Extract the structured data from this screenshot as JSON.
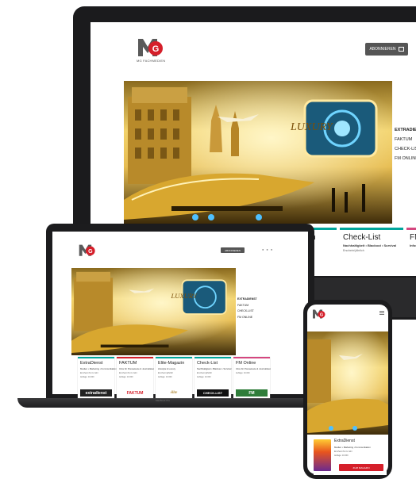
{
  "brand": {
    "logo_letters": "MG",
    "tagline": "MG FACHMEDIEN"
  },
  "monitor": {
    "subscribe_label": "ABONNIEREN",
    "hero_text": "LUXURY",
    "menu": [
      "EXTRADIENST",
      "FAKTUM",
      "CHECK-LIST",
      "FM ONLINE"
    ],
    "cards": [
      {
        "title": "n",
        "subtitle": "",
        "extra": ""
      },
      {
        "title": "Check-List",
        "subtitle": "Nachhaltigkeit • Blackout • Survival",
        "extra": "Erscheint jährlich"
      },
      {
        "title": "FM",
        "subtitle": "Infor",
        "extra": ""
      }
    ]
  },
  "laptop": {
    "subscribe_label": "ABONNIEREN",
    "hero_text": "LUXURY",
    "base_label": "MacBook Pro",
    "menu": [
      "EXTRADIENST",
      "FAKTUM",
      "CHECK-LIST",
      "FM ONLINE"
    ],
    "cards": [
      {
        "title": "ExtraDienst",
        "subtitle": "Medien • Marketing • Kommunikation",
        "extra": "Erscheint 6x im Jahr",
        "extra2": "Auflage: 10.000",
        "logo": "extradienst"
      },
      {
        "title": "FAKTUM",
        "subtitle": "Infos für Presseleute & Journalisten",
        "extra": "Erscheint 6x im Jahr",
        "extra2": "Auflage: 10.000",
        "logo": "FAKTUM"
      },
      {
        "title": "Elite-Magazin",
        "subtitle": "Lifestyle & Luxury",
        "extra": "Erscheint jährlich",
        "extra2": "Auflage: 10.000",
        "logo": "élite"
      },
      {
        "title": "Check-List",
        "subtitle": "Nachhaltigkeit • Blackout • Survival",
        "extra": "Erscheint jährlich",
        "extra2": "Auflage: 10.000",
        "logo": "CHECK-LIST"
      },
      {
        "title": "FM Online",
        "subtitle": "Infos für Presseleute & Journalisten",
        "extra": "Auflage: 10.000",
        "extra2": "",
        "logo": "FM"
      }
    ]
  },
  "phone": {
    "card": {
      "title": "ExtraDienst",
      "subtitle": "Medien • Marketing • Kommunikation",
      "extra": "Erscheint 6x im Jahr",
      "extra2": "Auflage: 10.000",
      "button": "ZUM MAGAZIN"
    }
  },
  "colors": {
    "teal": "#00a69c",
    "pink": "#d4477f",
    "red": "#d51f2a",
    "gold": "#e9c15a",
    "grey_button": "#555555"
  }
}
